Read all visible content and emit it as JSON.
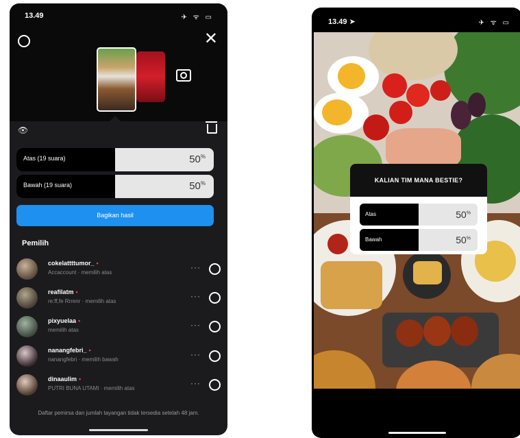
{
  "left": {
    "time": "13.49",
    "status_icons": "✈ ᯤ ▭",
    "close_icon": "✕",
    "eye_icon": "👁",
    "options": [
      {
        "label": "Atas (19 suara)",
        "percent": "50",
        "percent_sign": "%",
        "fill": 0.5
      },
      {
        "label": "Bawah (19 suara)",
        "percent": "50",
        "percent_sign": "%",
        "fill": 0.5
      }
    ],
    "share_label": "Bagikan hasil",
    "voters_title": "Pemilih",
    "voters": [
      {
        "name": "cokelattttumor_",
        "sub": "Accaccount · memilih atas"
      },
      {
        "name": "reafilatm",
        "sub": "re:ff,fe Rrrenr · memilih atas"
      },
      {
        "name": "pixyuelaa",
        "sub": "memilih atas"
      },
      {
        "name": "nanangfebri_",
        "sub": "nanangfebri · memilih bawah"
      },
      {
        "name": "dinaaulim",
        "sub": "PUTRI BUNA UTAMI · memilih atas"
      }
    ],
    "more_icon": "···",
    "footer_note": "Daftar pemirsa dan jumlah tayangan tidak tersedia setelah 48 jam."
  },
  "right": {
    "time": "13.49 ➤",
    "status_icons": "✈ ᯤ ▭",
    "question": "KALIAN TIM MANA BESTIE?",
    "options": [
      {
        "label": "Atas",
        "percent": "50",
        "percent_sign": "%",
        "fill": 0.5
      },
      {
        "label": "Bawah",
        "percent": "50",
        "percent_sign": "%",
        "fill": 0.5
      }
    ]
  },
  "colors": {
    "accent_blue": "#1e90ef",
    "dark_bg": "#1b1b1d",
    "alert_red": "#ff3a4a"
  }
}
